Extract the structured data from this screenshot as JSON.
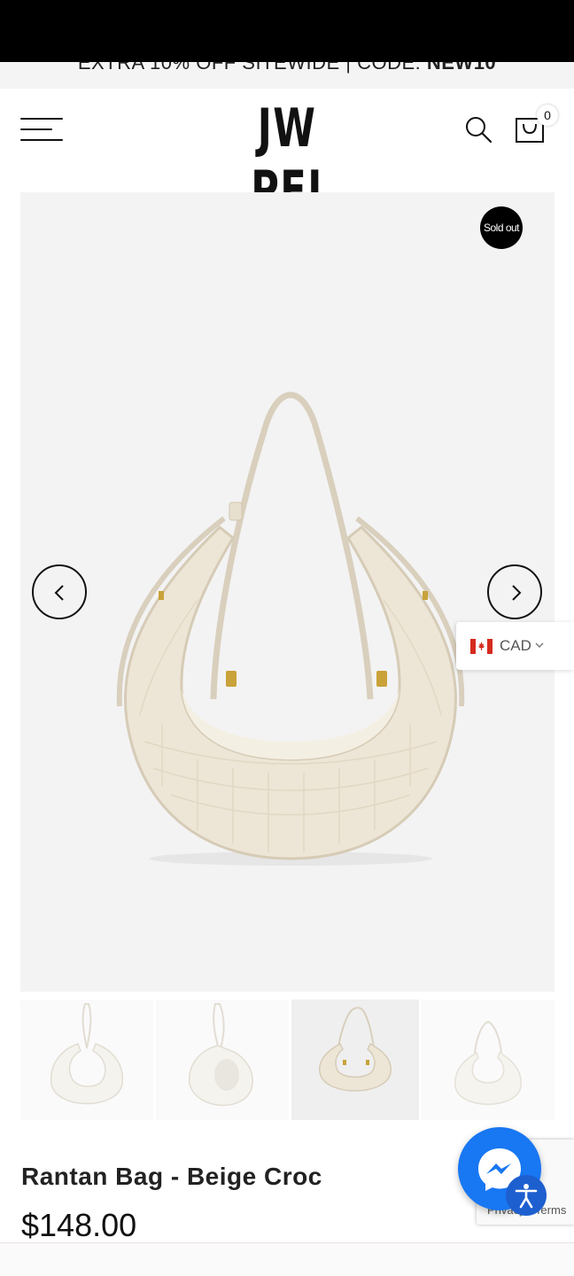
{
  "announcement": {
    "text_prefix": "EXTRA 10% OFF SITEWIDE | CODE: ",
    "code": "NEW10"
  },
  "header": {
    "menu_icon": "hamburger-menu-icon",
    "logo": "JW PEI",
    "search_icon": "search-icon",
    "cart_icon": "shopping-bag-icon",
    "cart_count": "0"
  },
  "gallery": {
    "badge": "Sold out",
    "prev_icon": "chevron-left-icon",
    "next_icon": "chevron-right-icon",
    "thumbnail_count": 4,
    "active_thumbnail": 3
  },
  "currency": {
    "code": "CAD",
    "flag_icon": "canada-flag-icon",
    "dropdown_icon": "chevron-down-icon"
  },
  "product": {
    "title": "Rantan Bag - Beige Croc",
    "price": "$148.00"
  },
  "widgets": {
    "recaptcha_text": "Privacy - Terms",
    "messenger_icon": "messenger-icon",
    "accessibility_icon": "accessibility-icon"
  },
  "colors": {
    "accent": "#1877f2",
    "badge_bg": "#000000",
    "bag_color": "#ede6d6"
  }
}
